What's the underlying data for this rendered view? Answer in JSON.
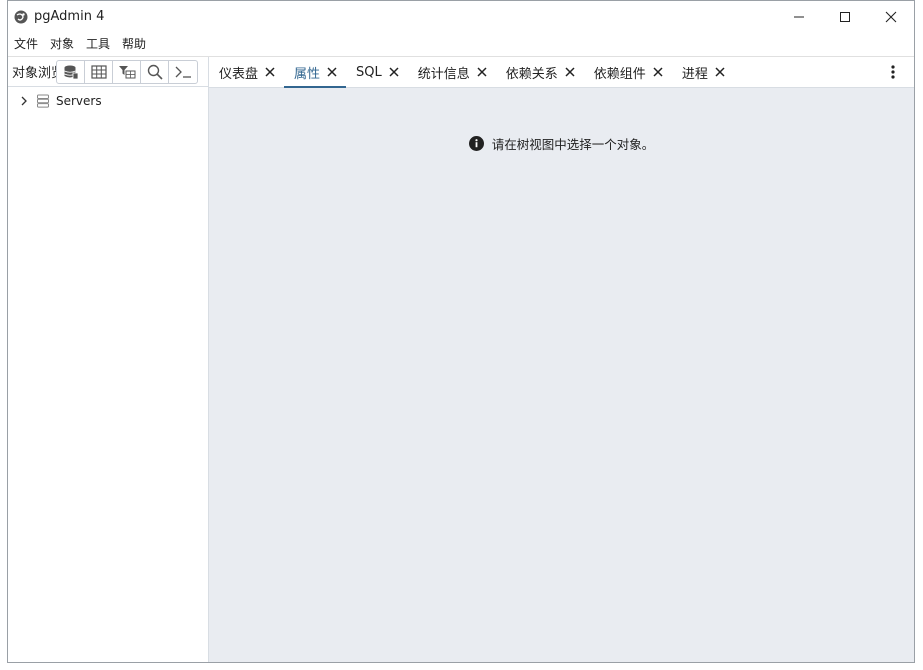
{
  "window": {
    "title": "pgAdmin 4"
  },
  "menubar": {
    "items": [
      "文件",
      "对象",
      "工具",
      "帮助"
    ]
  },
  "left_panel": {
    "title": "对象浏览器",
    "toolbar": [
      "database-icon",
      "table-icon",
      "filter-table-icon",
      "search-icon",
      "terminal-icon"
    ],
    "tree": [
      {
        "label": "Servers",
        "expanded": false
      }
    ]
  },
  "tabs": [
    {
      "label": "仪表盘",
      "active": false
    },
    {
      "label": "属性",
      "active": true
    },
    {
      "label": "SQL",
      "active": false
    },
    {
      "label": "统计信息",
      "active": false
    },
    {
      "label": "依赖关系",
      "active": false
    },
    {
      "label": "依赖组件",
      "active": false
    },
    {
      "label": "进程",
      "active": false
    }
  ],
  "content": {
    "message": "请在树视图中选择一个对象。"
  },
  "colors": {
    "accent": "#326690",
    "content_bg": "#e9ecf1"
  }
}
